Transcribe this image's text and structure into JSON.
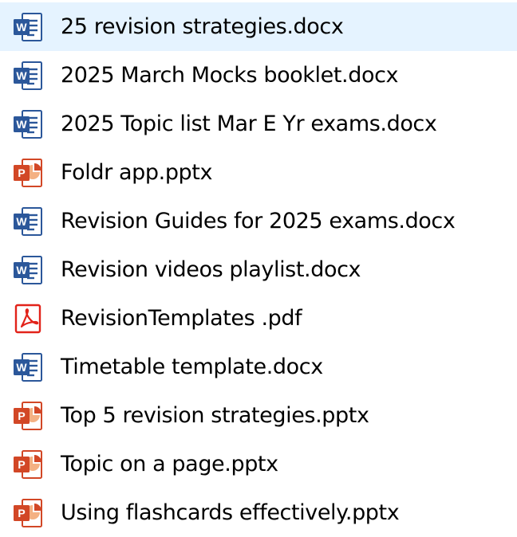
{
  "explorer": {
    "files": [
      {
        "name": "25 revision strategies.docx",
        "icon": "word-doc-icon",
        "state": "hovered"
      },
      {
        "name": "2025 March Mocks booklet.docx",
        "icon": "word-doc-icon",
        "state": ""
      },
      {
        "name": "2025 Topic list Mar E Yr exams.docx",
        "icon": "word-doc-icon",
        "state": ""
      },
      {
        "name": "Foldr app.pptx",
        "icon": "powerpoint-icon",
        "state": ""
      },
      {
        "name": "Revision Guides for 2025 exams.docx",
        "icon": "word-doc-icon",
        "state": ""
      },
      {
        "name": "Revision videos playlist.docx",
        "icon": "word-doc-icon",
        "state": ""
      },
      {
        "name": "RevisionTemplates .pdf",
        "icon": "pdf-icon",
        "state": ""
      },
      {
        "name": "Timetable template.docx",
        "icon": "word-doc-icon",
        "state": ""
      },
      {
        "name": "Top 5 revision strategies.pptx",
        "icon": "powerpoint-icon",
        "state": ""
      },
      {
        "name": "Topic on a page.pptx",
        "icon": "powerpoint-icon",
        "state": ""
      },
      {
        "name": "Using flashcards effectively.pptx",
        "icon": "powerpoint-icon",
        "state": ""
      }
    ]
  },
  "colors": {
    "word": "#2b579a",
    "powerpoint": "#d24726",
    "pdf": "#e2231a",
    "hover_bg": "#e5f3ff"
  }
}
